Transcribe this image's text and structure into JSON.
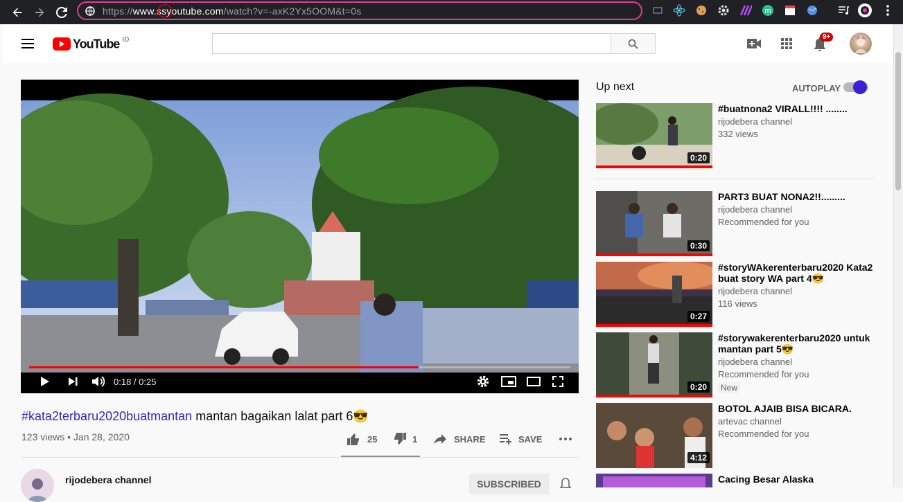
{
  "browser": {
    "url_prefix": "https://",
    "url_host": "www.ssyoutube.com",
    "url_path": "/watch?v=-axK2Yx5OOM&t=0s",
    "notif_badge": "9+"
  },
  "header": {
    "logo_text": "YouTube",
    "region": "ID",
    "search_placeholder": ""
  },
  "player": {
    "time": "0:18 / 0:25",
    "progress": 0.72
  },
  "video": {
    "title_tag": "#kata2terbaru2020buatmantan",
    "title_rest": "mantan bagaikan lalat part 6😎",
    "meta": "123 views • Jan 28, 2020",
    "likes": "25",
    "dislikes": "1",
    "share": "SHARE",
    "save": "SAVE"
  },
  "channel": {
    "name": "rijodebera channel",
    "subscribe": "SUBSCRIBED"
  },
  "sidebar": {
    "up_next": "Up next",
    "autoplay": "AUTOPLAY",
    "items": [
      {
        "title": "#buatnona2 VIRALL!!!! ........",
        "channel": "rijodebera channel",
        "info": "332 views",
        "duration": "0:20",
        "badge": ""
      },
      {
        "title": "PART3 BUAT NONA2!!.........",
        "channel": "rijodebera channel",
        "info": "Recommended for you",
        "duration": "0:30",
        "badge": ""
      },
      {
        "title": "#storyWAkerenterbaru2020 Kata2 buat story WA part 4😎",
        "channel": "rijodebera channel",
        "info": "116 views",
        "duration": "0:27",
        "badge": ""
      },
      {
        "title": "#storywakerenterbaru2020 untuk mantan part 5😎",
        "channel": "rijodebera channel",
        "info": "Recommended for you",
        "duration": "0:20",
        "badge": "New"
      },
      {
        "title": "BOTOL AJAIB BISA BICARA.",
        "channel": "artevac channel",
        "info": "Recommended for you",
        "duration": "4:12",
        "badge": ""
      },
      {
        "title": "Cacing Besar Alaska",
        "channel": "",
        "info": "",
        "duration": "",
        "badge": ""
      }
    ]
  },
  "colors": {
    "accent": "#e6399b",
    "red": "#ff0000",
    "link": "#3e1fc7",
    "autoplay": "#3d1fd6"
  }
}
